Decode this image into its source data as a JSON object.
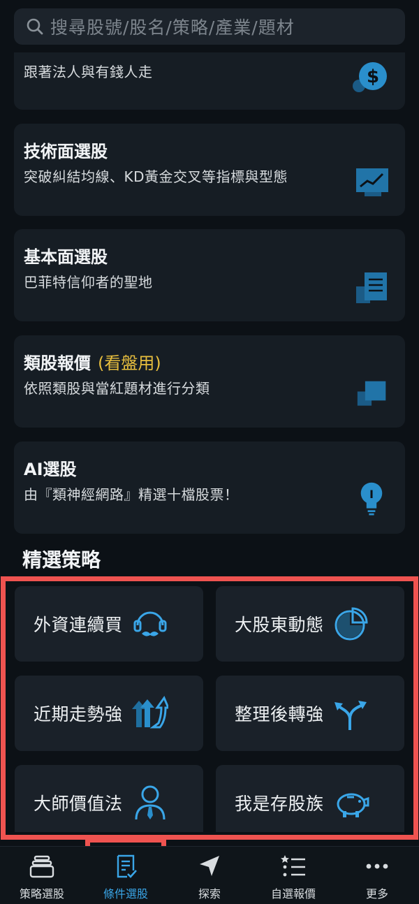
{
  "search": {
    "placeholder": "搜尋股號/股名/策略/產業/題材",
    "icon": "search-icon"
  },
  "cards": [
    {
      "title": "",
      "subtitle": "跟著法人與有錢人走",
      "icon": "dollar-coin-icon"
    },
    {
      "title": "技術面選股",
      "subtitle": "突破糾結均線、KD黃金交叉等指標與型態",
      "icon": "line-chart-icon"
    },
    {
      "title": "基本面選股",
      "subtitle": "巴菲特信仰者的聖地",
      "icon": "document-icon"
    },
    {
      "title": "類股報價",
      "highlight": "(看盤用)",
      "subtitle": "依照類股與當紅題材進行分類",
      "icon": "stacked-squares-icon"
    },
    {
      "title": "AI選股",
      "subtitle": "由『類神經網路』精選十檔股票！",
      "icon": "lightbulb-icon"
    }
  ],
  "section_title": "精選策略",
  "strategies": [
    {
      "label": "外資連續買",
      "icon": "foreigner-mustache-icon"
    },
    {
      "label": "大股東動態",
      "icon": "pie-chart-icon"
    },
    {
      "label": "近期走勢強",
      "icon": "rising-arrows-icon"
    },
    {
      "label": "整理後轉強",
      "icon": "split-arrows-icon"
    },
    {
      "label": "大師價值法",
      "icon": "person-tie-icon"
    },
    {
      "label": "我是存股族",
      "icon": "piggy-bank-icon"
    }
  ],
  "bottom_nav": [
    {
      "label": "策略選股",
      "icon": "stack-icon",
      "active": false
    },
    {
      "label": "條件選股",
      "icon": "checklist-icon",
      "active": true
    },
    {
      "label": "探索",
      "icon": "navigation-arrow-icon",
      "active": false
    },
    {
      "label": "自選報價",
      "icon": "star-list-icon",
      "active": false
    },
    {
      "label": "更多",
      "icon": "more-dots-icon",
      "active": false
    }
  ],
  "colors": {
    "accent": "#3aa6e8",
    "highlight": "#e7be3e",
    "annotation": "#ef5350",
    "icon_blue": "#1f6f9f"
  }
}
